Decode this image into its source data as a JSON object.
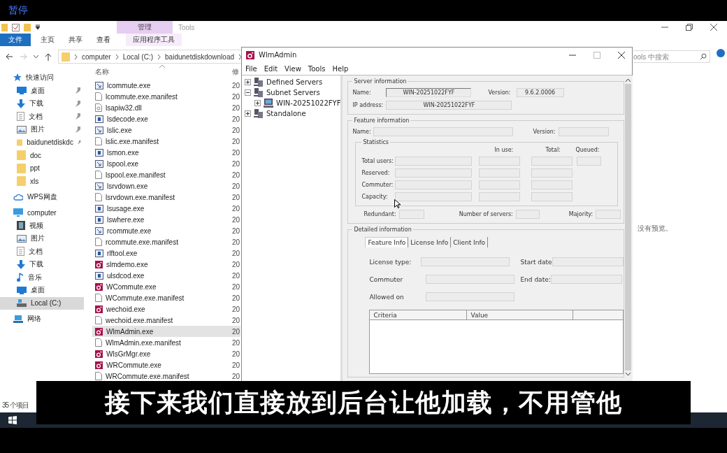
{
  "player": {
    "status": "暂停"
  },
  "explorer": {
    "context_tab": {
      "label": "管理"
    },
    "title": "Tools",
    "ribbon_tabs": [
      {
        "label": "文件",
        "kind": "file",
        "selected": false
      },
      {
        "label": "主页",
        "kind": "tab",
        "selected": false
      },
      {
        "label": "共享",
        "kind": "tab",
        "selected": false
      },
      {
        "label": "查看",
        "kind": "tab",
        "selected": false
      },
      {
        "label": "应用程序工具",
        "kind": "context",
        "selected": false
      }
    ],
    "path": [
      "computer",
      "Local (C:)",
      "baidunetdiskdownload"
    ],
    "search": {
      "placeholder": "ools 中搜索"
    },
    "nav": [
      {
        "label": "快速访问",
        "kind": "star",
        "selected": false,
        "children": [
          {
            "label": "桌面",
            "kind": "desktop",
            "pinned": true,
            "selected": false
          },
          {
            "label": "下载",
            "kind": "download",
            "pinned": true,
            "selected": false
          },
          {
            "label": "文档",
            "kind": "doc",
            "pinned": true,
            "selected": false
          },
          {
            "label": "图片",
            "kind": "picture",
            "pinned": true,
            "selected": false
          },
          {
            "label": "baidunetdiskdc",
            "kind": "folder",
            "pinned": true,
            "selected": false
          },
          {
            "label": "doc",
            "kind": "folder",
            "pinned": false,
            "selected": false
          },
          {
            "label": "ppt",
            "kind": "folder",
            "pinned": false,
            "selected": false
          },
          {
            "label": "xls",
            "kind": "folder",
            "pinned": false,
            "selected": false
          }
        ]
      },
      {
        "label": "WPS网盘",
        "kind": "cloud",
        "selected": false
      },
      {
        "label": "computer",
        "kind": "pc",
        "selected": false,
        "children": [
          {
            "label": "视频",
            "kind": "video",
            "pinned": false,
            "selected": false
          },
          {
            "label": "图片",
            "kind": "picture",
            "pinned": false,
            "selected": false
          },
          {
            "label": "文档",
            "kind": "doc",
            "pinned": false,
            "selected": false
          },
          {
            "label": "下载",
            "kind": "download",
            "pinned": false,
            "selected": false
          },
          {
            "label": "音乐",
            "kind": "music",
            "pinned": false,
            "selected": false
          },
          {
            "label": "桌面",
            "kind": "desktop",
            "pinned": false,
            "selected": false
          },
          {
            "label": "Local (C:)",
            "kind": "drive",
            "pinned": false,
            "selected": true
          }
        ]
      },
      {
        "label": "网络",
        "kind": "network",
        "selected": false
      }
    ],
    "columns": [
      "名称",
      "修"
    ],
    "files": [
      {
        "name": "lcommute.exe",
        "kind": "app-arrow",
        "date": "20",
        "selected": false
      },
      {
        "name": "lcommute.exe.manifest",
        "kind": "file",
        "date": "20",
        "selected": false
      },
      {
        "name": "lsapiw32.dll",
        "kind": "dll",
        "date": "20",
        "selected": false
      },
      {
        "name": "lsdecode.exe",
        "kind": "app",
        "date": "20",
        "selected": false
      },
      {
        "name": "lslic.exe",
        "kind": "app-arrow",
        "date": "20",
        "selected": false
      },
      {
        "name": "lslic.exe.manifest",
        "kind": "file",
        "date": "20",
        "selected": false
      },
      {
        "name": "lsmon.exe",
        "kind": "app",
        "date": "20",
        "selected": false
      },
      {
        "name": "lspool.exe",
        "kind": "app-arrow",
        "date": "20",
        "selected": false
      },
      {
        "name": "lspool.exe.manifest",
        "kind": "file",
        "date": "20",
        "selected": false
      },
      {
        "name": "lsrvdown.exe",
        "kind": "app-arrow",
        "date": "20",
        "selected": false
      },
      {
        "name": "lsrvdown.exe.manifest",
        "kind": "file",
        "date": "20",
        "selected": false
      },
      {
        "name": "lsusage.exe",
        "kind": "app",
        "date": "20",
        "selected": false
      },
      {
        "name": "lswhere.exe",
        "kind": "app",
        "date": "20",
        "selected": false
      },
      {
        "name": "rcommute.exe",
        "kind": "app-arrow",
        "date": "20",
        "selected": false
      },
      {
        "name": "rcommute.exe.manifest",
        "kind": "file",
        "date": "20",
        "selected": false
      },
      {
        "name": "rlftool.exe",
        "kind": "app",
        "date": "20",
        "selected": false
      },
      {
        "name": "slmdemo.exe",
        "kind": "red",
        "date": "20",
        "selected": false
      },
      {
        "name": "ulsdcod.exe",
        "kind": "app",
        "date": "20",
        "selected": false
      },
      {
        "name": "WCommute.exe",
        "kind": "red",
        "date": "20",
        "selected": false
      },
      {
        "name": "WCommute.exe.manifest",
        "kind": "file",
        "date": "20",
        "selected": false
      },
      {
        "name": "wechoid.exe",
        "kind": "red",
        "date": "20",
        "selected": false
      },
      {
        "name": "wechoid.exe.manifest",
        "kind": "file",
        "date": "20",
        "selected": false
      },
      {
        "name": "WlmAdmin.exe",
        "kind": "red",
        "date": "20",
        "selected": true
      },
      {
        "name": "WlmAdmin.exe.manifest",
        "kind": "file",
        "date": "20",
        "selected": false
      },
      {
        "name": "WlsGrMgr.exe",
        "kind": "red",
        "date": "20",
        "selected": false
      },
      {
        "name": "WRCommute.exe",
        "kind": "red",
        "date": "20",
        "selected": false
      },
      {
        "name": "WRCommute.exe.manifest",
        "kind": "file",
        "date": "20",
        "selected": false
      }
    ],
    "status": "35 个项目",
    "preview": "没有预览。"
  },
  "wlm": {
    "title": "WlmAdmin",
    "menu": [
      "File",
      "Edit",
      "View",
      "Tools",
      "Help"
    ],
    "tree": [
      {
        "label": "Defined Servers",
        "kind": "group",
        "expanded": false
      },
      {
        "label": "Subnet Servers",
        "kind": "group",
        "expanded": true,
        "children": [
          {
            "label": "WIN-20251022FYF",
            "kind": "computer",
            "expanded": false
          }
        ]
      },
      {
        "label": "Standalone",
        "kind": "group",
        "expanded": false
      }
    ],
    "server_info": {
      "title": "Server information",
      "name_label": "Name:",
      "name": "WIN-20251022FYF",
      "version_label": "Version:",
      "version": "9.6.2.0006",
      "ip_label": "IP address:",
      "ip": "WIN-20251022FYF"
    },
    "feature_info": {
      "title": "Feature information",
      "name_label": "Name:",
      "version_label": "Version:",
      "statistics": {
        "title": "Statistics",
        "columns": [
          "In use:",
          "Total:",
          "Queued:"
        ],
        "rows": [
          {
            "label": "Total users:",
            "kind": "queued"
          },
          {
            "label": "Reserved:",
            "kind": "plain"
          },
          {
            "label": "Commuter:",
            "kind": "plain"
          },
          {
            "label": "Capacity:",
            "kind": "plain"
          }
        ]
      },
      "redundant_label": "Redundant:",
      "servers_label": "Number of servers:",
      "majority_label": "Majority:"
    },
    "detailed_info": {
      "title": "Detailed information",
      "tabs": [
        {
          "label": "Feature Info",
          "selected": true
        },
        {
          "label": "License Info",
          "selected": false
        },
        {
          "label": "Client Info",
          "selected": false
        }
      ],
      "left_fields": [
        "License type:",
        "Commuter",
        "Allowed on"
      ],
      "right_fields": [
        "Start date",
        "End date:"
      ],
      "table_columns": [
        "Criteria",
        "Value"
      ]
    }
  },
  "subtitle": "接下来我们直接放到后台让他加载，不用管他"
}
